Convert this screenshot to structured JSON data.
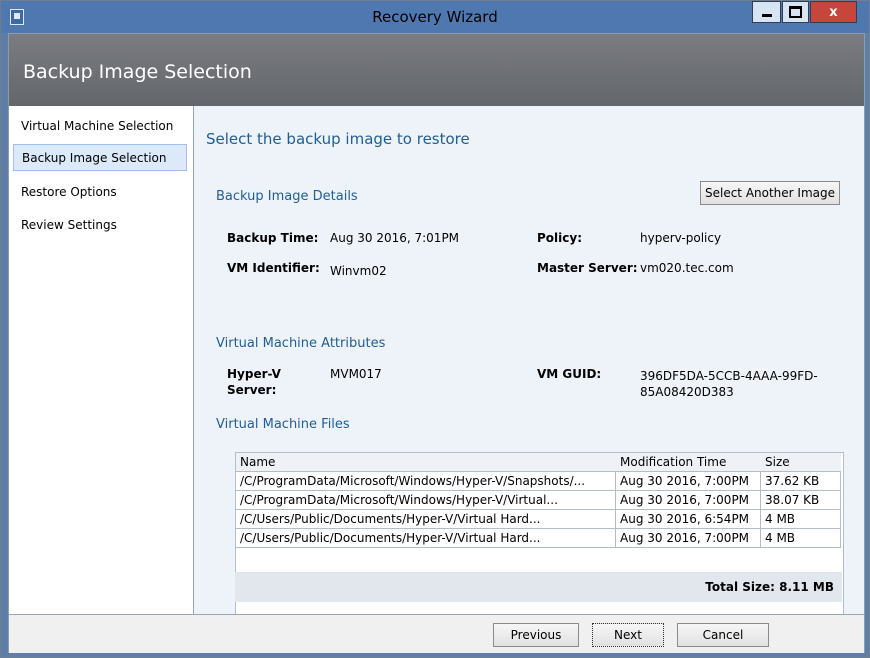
{
  "window": {
    "title": "Recovery Wizard",
    "close_glyph": "x"
  },
  "header": {
    "title": "Backup Image Selection"
  },
  "sidebar": {
    "items": [
      {
        "label": "Virtual Machine Selection",
        "active": false
      },
      {
        "label": "Backup Image Selection",
        "active": true
      },
      {
        "label": "Restore Options",
        "active": false
      },
      {
        "label": "Review Settings",
        "active": false
      }
    ]
  },
  "main": {
    "heading": "Select the backup image to restore",
    "details": {
      "heading": "Backup Image Details",
      "select_another_label": "Select Another Image",
      "backup_time_label": "Backup Time:",
      "backup_time_value": "Aug 30 2016, 7:01PM",
      "policy_label": "Policy:",
      "policy_value": "hyperv-policy",
      "vm_identifier_label": "VM Identifier:",
      "vm_identifier_value": "Winvm02",
      "master_server_label": "Master Server:",
      "master_server_value": "vm020.tec.com"
    },
    "attributes": {
      "heading": "Virtual Machine Attributes",
      "hyperv_server_label_line1": "Hyper-V",
      "hyperv_server_label_line2": "Server:",
      "hyperv_server_value": "MVM017",
      "vm_guid_label": "VM GUID:",
      "vm_guid_value_line1": "396DF5DA-5CCB-4AAA-99FD-",
      "vm_guid_value_line2": "85A08420D383"
    },
    "files": {
      "heading": "Virtual Machine Files",
      "columns": [
        "Name",
        "Modification Time",
        "Size"
      ],
      "rows": [
        {
          "name": "/C/ProgramData/Microsoft/Windows/Hyper-V/Snapshots/...",
          "time": "Aug 30 2016, 7:00PM",
          "size": "37.62 KB"
        },
        {
          "name": "/C/ProgramData/Microsoft/Windows/Hyper-V/Virtual...",
          "time": "Aug 30 2016, 7:00PM",
          "size": "38.07 KB"
        },
        {
          "name": "/C/Users/Public/Documents/Hyper-V/Virtual Hard...",
          "time": "Aug 30 2016, 6:54PM",
          "size": "4 MB"
        },
        {
          "name": "/C/Users/Public/Documents/Hyper-V/Virtual Hard...",
          "time": "Aug 30 2016, 7:00PM",
          "size": "4 MB"
        }
      ],
      "total": "Total Size: 8.11 MB"
    }
  },
  "footer": {
    "previous_label": "Previous",
    "next_label": "Next",
    "cancel_label": "Cancel"
  }
}
